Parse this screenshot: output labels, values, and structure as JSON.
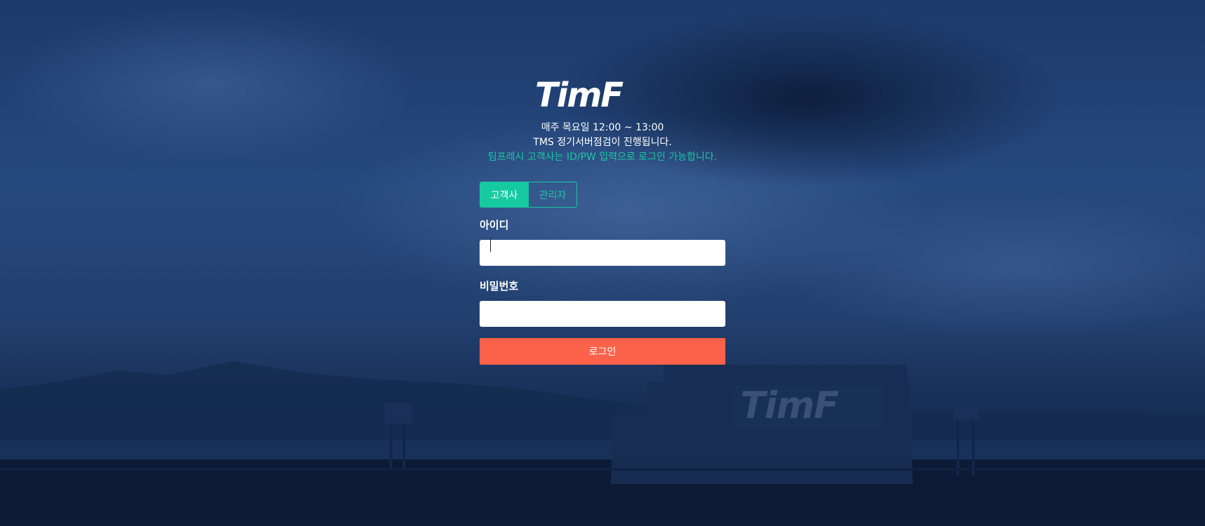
{
  "brand": {
    "logo_text": "TimF",
    "watermark_text": "TimF"
  },
  "notice": {
    "line1": "매주 목요일 12:00 ~ 13:00",
    "line2": "TMS 정기서버점검이 진행됩니다.",
    "line3": "팀프레시 고객사는 ID/PW 입력으로 로그인 가능합니다."
  },
  "tabs": [
    {
      "label": "고객사",
      "active": true
    },
    {
      "label": "관리자",
      "active": false
    }
  ],
  "form": {
    "id_label": "아이디",
    "id_value": "",
    "password_label": "비밀번호",
    "password_value": "",
    "login_label": "로그인"
  },
  "colors": {
    "accent": "#17c9a0",
    "login_button": "#fc6249",
    "background": "#1f3f72"
  }
}
